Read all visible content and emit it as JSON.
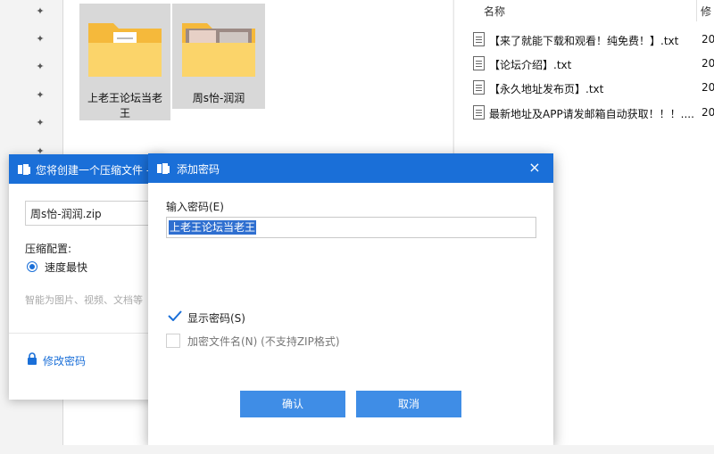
{
  "explorer": {
    "pins": [
      "pin-icon",
      "pin-icon",
      "pin-icon",
      "pin-icon",
      "pin-icon",
      "pin-icon"
    ],
    "folders": [
      {
        "name_line1": "上老王论坛当老",
        "name_line2": "王"
      },
      {
        "name_line1": "周s怡-润润",
        "name_line2": ""
      }
    ],
    "columns": {
      "name": "名称",
      "modified": "修"
    },
    "files": [
      {
        "name": "【来了就能下载和观看！纯免费！】.txt",
        "date": "20"
      },
      {
        "name": "【论坛介绍】.txt",
        "date": "20"
      },
      {
        "name": "【永久地址发布页】.txt",
        "date": "20"
      },
      {
        "name": "最新地址及APP请发邮箱自动获取！！！....",
        "date": "20"
      }
    ]
  },
  "dialog_compress": {
    "title": "您将创建一个压缩文件 -",
    "filename": "周s怡-润润.zip",
    "config_label": "压缩配置:",
    "speed_option": "速度最快",
    "hint": "智能为图片、视频、文档等",
    "modify_password": "修改密码"
  },
  "dialog_password": {
    "title": "添加密码",
    "close": "×",
    "input_label": "输入密码(E)",
    "input_value": "上老王论坛当老王",
    "show_password_label": "显示密码(S)",
    "encrypt_names_label": "加密文件名(N) (不支持ZIP格式)",
    "ok_label": "确认",
    "cancel_label": "取消"
  },
  "colors": {
    "accent": "#1a6fd8",
    "button": "#3f8de6"
  }
}
